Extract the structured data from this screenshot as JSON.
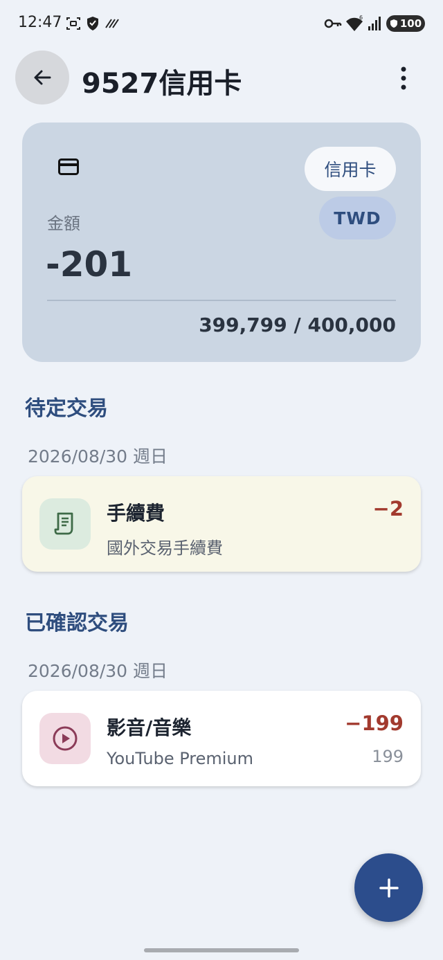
{
  "status_bar": {
    "time": "12:47",
    "battery": "100",
    "icons": [
      "screenshot-icon",
      "shield-icon",
      "data-saver-icon",
      "vpn-key-icon",
      "wifi-icon",
      "signal-icon",
      "battery-icon"
    ]
  },
  "header": {
    "title": "9527信用卡",
    "back_icon": "arrow-left-icon",
    "menu_icon": "more-vert-icon"
  },
  "account": {
    "icon": "credit-card-icon",
    "type_chip": "信用卡",
    "currency_chip": "TWD",
    "amount_label": "金額",
    "amount": "-201",
    "limit": "399,799 / 400,000"
  },
  "pending": {
    "section_title": "待定交易",
    "groups": [
      {
        "date": "2026/08/30 週日",
        "items": [
          {
            "icon": "receipt-icon",
            "title": "手續費",
            "subtitle": "國外交易手續費",
            "amount": "−2",
            "original": ""
          }
        ]
      }
    ]
  },
  "confirmed": {
    "section_title": "已確認交易",
    "groups": [
      {
        "date": "2026/08/30 週日",
        "items": [
          {
            "icon": "play-circle-icon",
            "title": "影音/音樂",
            "subtitle": "YouTube Premium",
            "amount": "−199",
            "original": "199"
          }
        ]
      }
    ]
  },
  "fab": {
    "icon": "plus-icon"
  },
  "colors": {
    "background": "#eef2f8",
    "card": "#cbd6e3",
    "accent": "#2e4d7e",
    "negative": "#a23a2e",
    "pending_card": "#f8f7e8",
    "fab": "#2c4d8c"
  }
}
